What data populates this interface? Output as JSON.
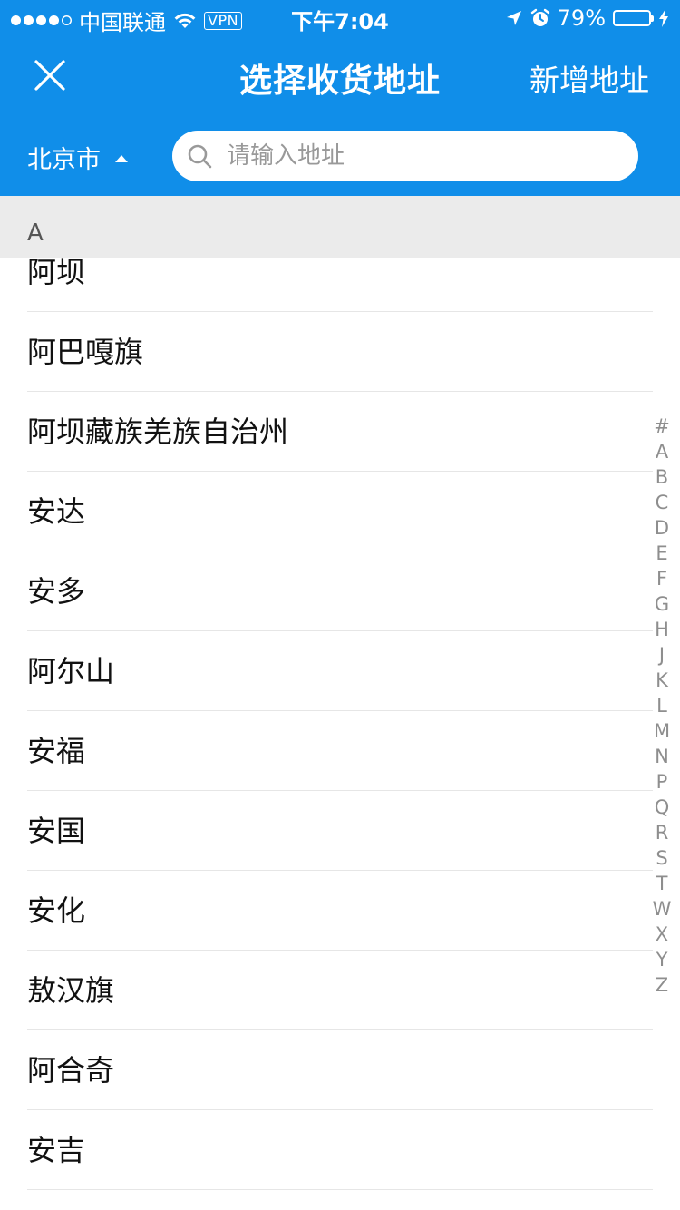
{
  "status_bar": {
    "carrier": "中国联通",
    "vpn": "VPN",
    "time": "下午7:04",
    "battery": "79%",
    "battery_level": 0.79,
    "colors": {
      "battery_fill": "#4cd964"
    }
  },
  "nav": {
    "title": "选择收货地址",
    "add_label": "新增地址"
  },
  "filter": {
    "city": "北京市",
    "search_placeholder": "请输入地址"
  },
  "section": {
    "letter": "A"
  },
  "list": {
    "items": [
      "阿坝",
      "阿巴嘎旗",
      "阿坝藏族羌族自治州",
      "安达",
      "安多",
      "阿尔山",
      "安福",
      "安国",
      "安化",
      "敖汉旗",
      "阿合奇",
      "安吉"
    ]
  },
  "index": {
    "letters": [
      "#",
      "A",
      "B",
      "C",
      "D",
      "E",
      "F",
      "G",
      "H",
      "J",
      "K",
      "L",
      "M",
      "N",
      "P",
      "Q",
      "R",
      "S",
      "T",
      "W",
      "X",
      "Y",
      "Z"
    ]
  },
  "colors": {
    "brand": "#108ee9",
    "section_bg": "#ebebeb",
    "index_text": "#8e8e8e"
  }
}
